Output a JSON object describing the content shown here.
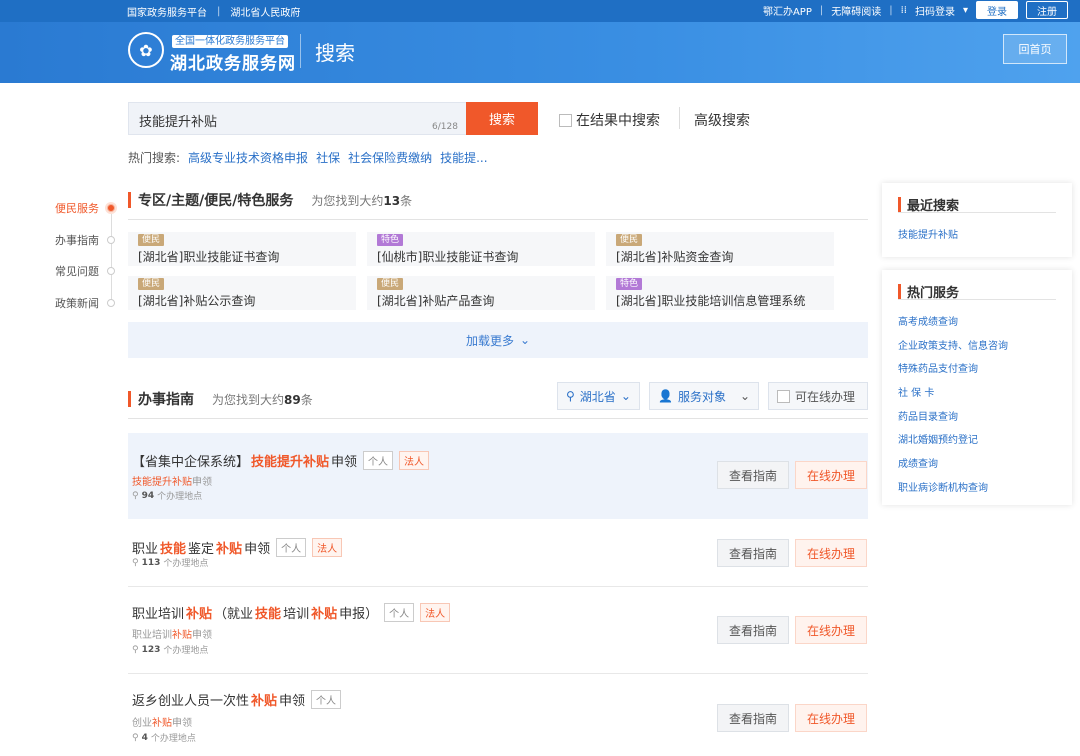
{
  "topbar": {
    "left_links": [
      "国家政务服务平台",
      "湖北省人民政府"
    ],
    "app": "鄂汇办APP",
    "accessibility": "无障碍阅读",
    "scan_login": "扫码登录",
    "login": "登录",
    "register": "注册"
  },
  "header": {
    "logo_small": "全国一体化政务服务平台",
    "logo_main": "湖北政务服务网",
    "page_title": "搜索",
    "home": "回首页"
  },
  "search": {
    "query": "技能提升补贴",
    "count": "6/128",
    "button": "搜索",
    "in_result": "在结果中搜索",
    "advanced": "高级搜索",
    "hot_label": "热门搜索:",
    "hot_links": [
      "高级专业技术资格申报",
      "社保",
      "社会保险费缴纳",
      "技能提..."
    ]
  },
  "leftnav": [
    "便民服务",
    "办事指南",
    "常见问题",
    "政策新闻"
  ],
  "services": {
    "title": "专区/主题/便民/特色服务",
    "found_prefix": "为您找到大约",
    "found_count": "13",
    "found_suffix": "条",
    "cards": [
      {
        "tag": "便民",
        "title": "[湖北省]职业技能证书查询"
      },
      {
        "tag": "特色",
        "title": "[仙桃市]职业技能证书查询"
      },
      {
        "tag": "便民",
        "title": "[湖北省]补贴资金查询"
      },
      {
        "tag": "便民",
        "title": "[湖北省]补贴公示查询"
      },
      {
        "tag": "便民",
        "title": "[湖北省]补贴产品查询"
      },
      {
        "tag": "特色",
        "title": "[湖北省]职业技能培训信息管理系统"
      }
    ],
    "load_more": "加载更多"
  },
  "guide": {
    "title": "办事指南",
    "found_prefix": "为您找到大约",
    "found_count": "89",
    "found_suffix": "条",
    "filter_region": "湖北省",
    "filter_target": "服务对象",
    "filter_online": "可在线办理",
    "btn_guide": "查看指南",
    "btn_online": "在线办理",
    "loc_suffix": "个办理地点",
    "rows": [
      {
        "t1": "【省集中企保系统】",
        "t2": "技能提升补贴",
        "t3": "申领",
        "pills": [
          "个人",
          "法人"
        ],
        "s1": "技能提升补贴",
        "s2": "申领",
        "loc": "94"
      },
      {
        "t1": "职业",
        "t2": "技能",
        "t3": "鉴定",
        "t4": "补贴",
        "t5": "申领",
        "pills": [
          "个人",
          "法人"
        ],
        "loc": "113"
      },
      {
        "t1": "职业培训",
        "t2": "补贴",
        "t3": "（就业",
        "t4": "技能",
        "t5": "培训",
        "t6": "补贴",
        "t7": "申报）",
        "pills": [
          "个人",
          "法人"
        ],
        "s1": "职业培训",
        "s2": "补贴",
        "s3": "申领",
        "loc": "123"
      },
      {
        "t1": "返乡创业人员一次性",
        "t2": "补贴",
        "t3": "申领",
        "pills": [
          "个人"
        ],
        "s1": "创业",
        "s2": "补贴",
        "s3": "申领",
        "loc": "4"
      }
    ]
  },
  "recent": {
    "title": "最近搜索",
    "items": [
      "技能提升补贴"
    ]
  },
  "hot_services": {
    "title": "热门服务",
    "items": [
      "高考成绩查询",
      "企业政策支持、信息咨询",
      "特殊药品支付查询",
      "社 保 卡",
      "药品目录查询",
      "湖北婚姻预约登记",
      "成绩查询",
      "职业病诊断机构查询"
    ]
  }
}
